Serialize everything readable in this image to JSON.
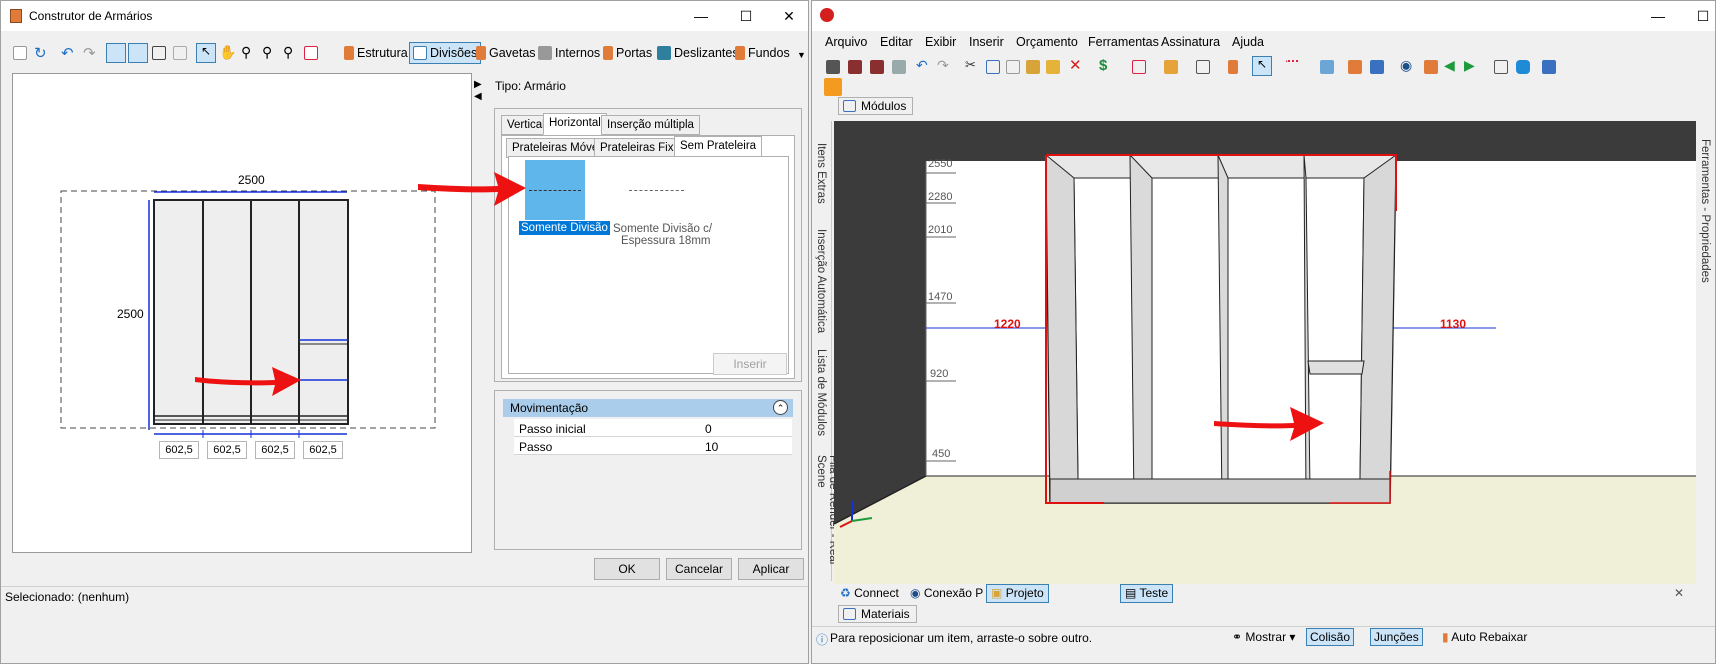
{
  "left_window": {
    "title": "Construtor de Armários",
    "toolbar": {
      "estrutura": "Estrutura",
      "divisoes": "Divisões",
      "gavetas": "Gavetas",
      "internos": "Internos",
      "portas": "Portas",
      "deslizantes": "Deslizantes",
      "fundos": "Fundos"
    },
    "drawing": {
      "width_label": "2500",
      "height_label": "2500",
      "column_widths": [
        "602,5",
        "602,5",
        "602,5",
        "602,5"
      ]
    },
    "tipo": "Tipo: Armário",
    "tabs_top": [
      "Vertical",
      "Horizontal",
      "Inserção múltipla"
    ],
    "tabs_sub": [
      "Prateleiras Móveis",
      "Prateleiras Fixas",
      "Sem Prateleira"
    ],
    "option_1": "Somente Divisão",
    "option_2_line1": "Somente Divisão c/",
    "option_2_line2": "Espessura 18mm",
    "inserir": "Inserir",
    "movimentacao": {
      "header": "Movimentação",
      "rows": [
        {
          "label": "Passo inicial",
          "value": "0"
        },
        {
          "label": "Passo",
          "value": "10"
        }
      ]
    },
    "buttons": {
      "ok": "OK",
      "cancelar": "Cancelar",
      "aplicar": "Aplicar"
    },
    "status": "Selecionado: (nenhum)"
  },
  "right_window": {
    "menu": [
      "Arquivo",
      "Editar",
      "Exibir",
      "Inserir",
      "Orçamento",
      "Ferramentas",
      "Assinatura",
      "Ajuda"
    ],
    "doc_tab": "Módulos",
    "side_tabs": [
      "Itens Extras",
      "Inserção Automática",
      "Lista de Módulos",
      "Fila de Render - Real Scene"
    ],
    "right_side_tab": "Ferramentas - Propriedades",
    "ruler": [
      "2550",
      "2280",
      "2010",
      "1470",
      "920",
      "450"
    ],
    "dim_left": "1220",
    "dim_right": "1130",
    "bottom_tabs": [
      "Connect",
      "Conexão P",
      "Projeto",
      "Teste"
    ],
    "materiais": "Materiais",
    "status": "Para reposicionar um item, arraste-o sobre outro.",
    "status_right": {
      "mostrar": "Mostrar",
      "colisao": "Colisão",
      "juncoes": "Junções",
      "auto": "Auto Rebaixar"
    }
  },
  "colors": {
    "selection": "#5eb6ea",
    "accent": "#0078d7",
    "arrow": "#ee1111"
  }
}
